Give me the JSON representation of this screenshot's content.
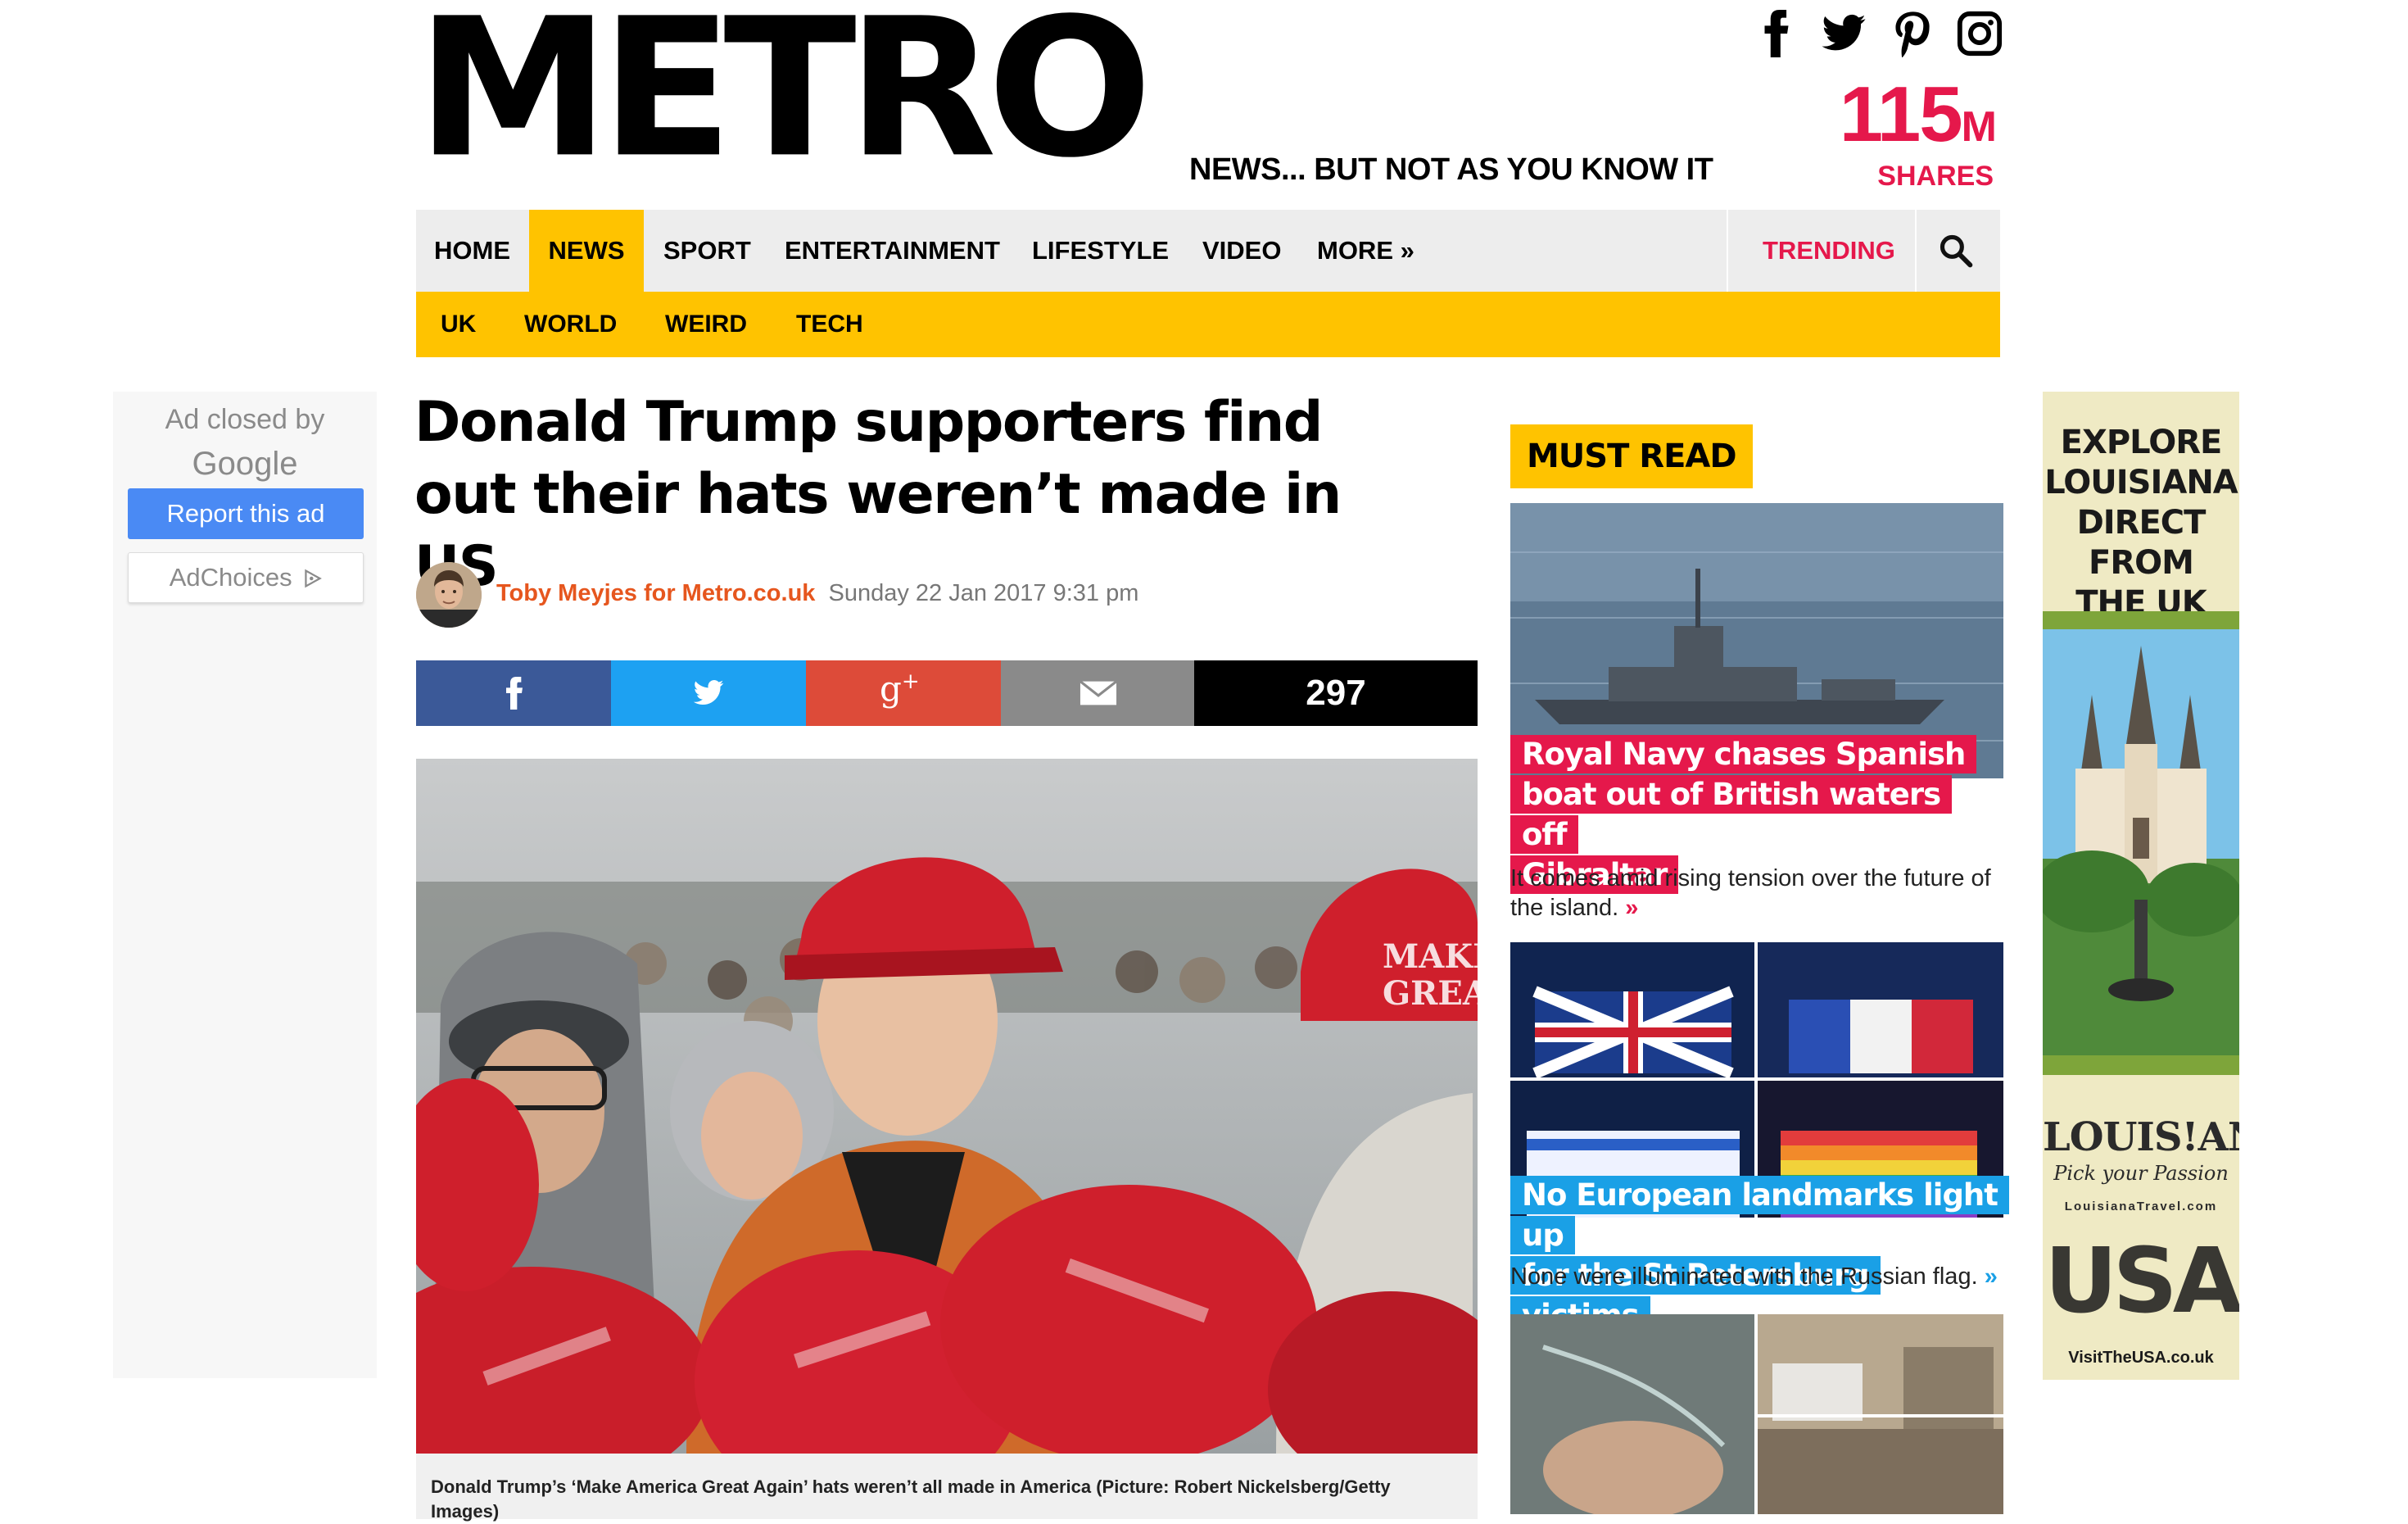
{
  "header": {
    "logo": "METRO",
    "tagline": "NEWS... BUT NOT AS YOU KNOW IT",
    "shares_number": "115",
    "shares_unit": "M",
    "shares_label": "SHARES",
    "social_icons": [
      "facebook-icon",
      "twitter-icon",
      "pinterest-icon",
      "instagram-icon"
    ]
  },
  "nav": {
    "items": [
      "HOME",
      "NEWS",
      "SPORT",
      "ENTERTAINMENT",
      "LIFESTYLE",
      "VIDEO",
      "MORE »"
    ],
    "active": "NEWS",
    "trending": "TRENDING",
    "search_icon": "search-icon"
  },
  "subnav": {
    "items": [
      "UK",
      "WORLD",
      "WEIRD",
      "TECH"
    ]
  },
  "ad_left": {
    "closed_by": "Ad closed by",
    "closed_brand": "Google",
    "report": "Report this ad",
    "adchoices": "AdChoices"
  },
  "article": {
    "headline": "Donald Trump supporters find out their hats weren’t made in US",
    "author": "Toby Meyjes for Metro.co.uk",
    "date": "Sunday 22 Jan 2017 9:31 pm",
    "share_count": "297",
    "share_icons": [
      "facebook-icon",
      "twitter-icon",
      "google-plus-icon",
      "email-icon"
    ],
    "photo_hat_text_1": "MAKE A",
    "photo_hat_text_2": "GREAT A",
    "caption": "Donald Trump’s ‘Make America Great Again’ hats weren’t all made in America (Picture: Robert Nickelsberg/Getty Images)"
  },
  "must_read": {
    "label": "MUST READ",
    "cards": [
      {
        "title_lines": [
          "Royal Navy chases Spanish",
          "boat out of British waters off",
          "Gibraltar"
        ],
        "desc": "It comes amid rising tension over the future of the island.",
        "more": "»",
        "color": "#e5184b"
      },
      {
        "title_lines": [
          "No European landmarks light up",
          "for the St Petersburg victims"
        ],
        "desc": "None were illuminated with the Russian flag.",
        "more": "»",
        "color": "#1aa0e6"
      }
    ]
  },
  "ad_right": {
    "headline_lines": [
      "EXPLORE",
      "LOUISIANA",
      "DIRECT FROM",
      "THE UK"
    ],
    "logo": "LOUIS!ANA",
    "tagline": "Pick your Passion",
    "url": "LouisianaTravel.com",
    "usa": "USA",
    "usa_url": "VisitTheUSA.co.uk"
  },
  "colors": {
    "brand_yellow": "#ffc300",
    "brand_pink": "#e5184b",
    "facebook": "#3b5998",
    "twitter": "#1da1f2",
    "google_plus": "#dd4b39",
    "email": "#8a8a8a"
  }
}
